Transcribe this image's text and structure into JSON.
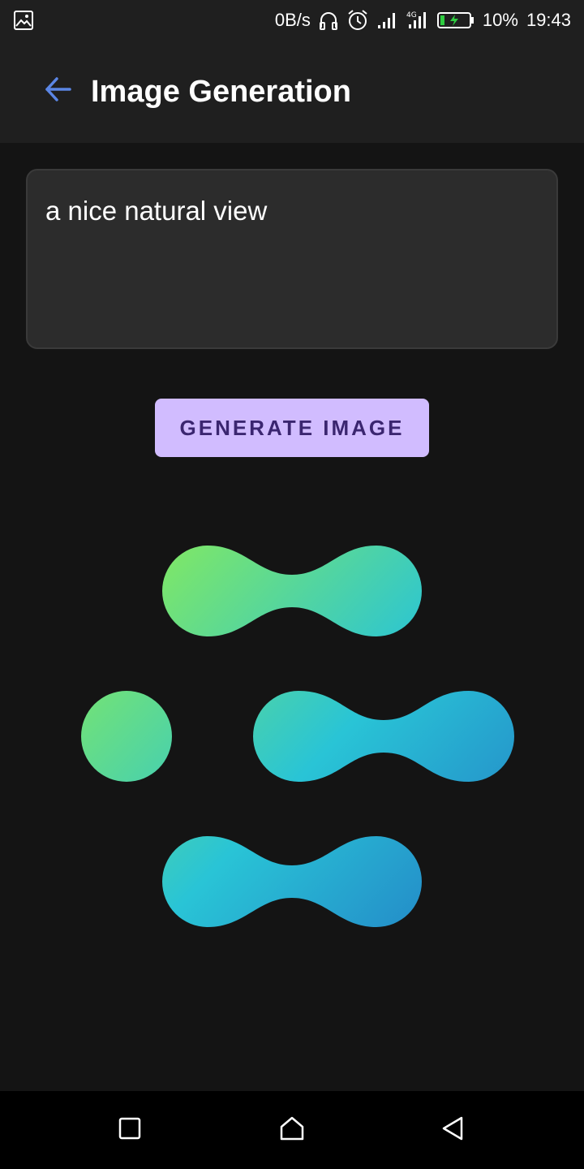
{
  "status_bar": {
    "net_speed": "0B/s",
    "battery": "10%",
    "time": "19:43",
    "icons": [
      "image-icon",
      "headphones-icon",
      "alarm-icon",
      "signal-icon",
      "signal-icon",
      "battery-charging-icon"
    ]
  },
  "app_bar": {
    "title": "Image Generation",
    "back_icon": "arrow-left-icon"
  },
  "prompt": {
    "value": "a nice natural view"
  },
  "generate_button": {
    "label": "GENERATE IMAGE"
  },
  "colors": {
    "accent": "#d1bcff",
    "accent_text": "#3b2670",
    "back_arrow": "#5b86e5",
    "gradient_start": "#95f04a",
    "gradient_mid": "#29c4d6",
    "gradient_end": "#2279c4"
  },
  "nav_bar": {
    "icons": [
      "square-icon",
      "home-icon",
      "back-triangle-icon"
    ]
  }
}
